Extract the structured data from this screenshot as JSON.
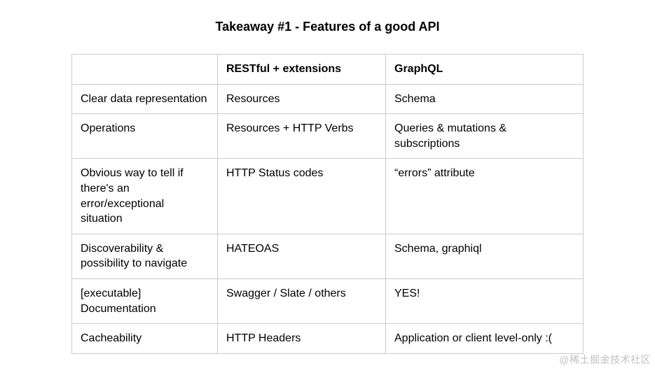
{
  "title": "Takeaway #1 - Features of a good API",
  "headers": {
    "feature": "",
    "restful": "RESTful + extensions",
    "graphql": "GraphQL"
  },
  "rows": [
    {
      "feature": "Clear data representation",
      "restful": "Resources",
      "graphql": "Schema"
    },
    {
      "feature": "Operations",
      "restful": "Resources + HTTP Verbs",
      "graphql": "Queries & mutations & subscriptions"
    },
    {
      "feature": "Obvious way to tell if there's an error/exceptional situation",
      "restful": "HTTP Status codes",
      "graphql": "“errors” attribute"
    },
    {
      "feature": "Discoverability & possibility to navigate",
      "restful": "HATEOAS",
      "graphql": "Schema, graphiql"
    },
    {
      "feature": "[executable] Documentation",
      "restful": "Swagger / Slate / others",
      "graphql": "YES!"
    },
    {
      "feature": "Cacheability",
      "restful": "HTTP Headers",
      "graphql": "Application or client level-only :("
    }
  ],
  "watermark": "@稀土掘金技术社区"
}
